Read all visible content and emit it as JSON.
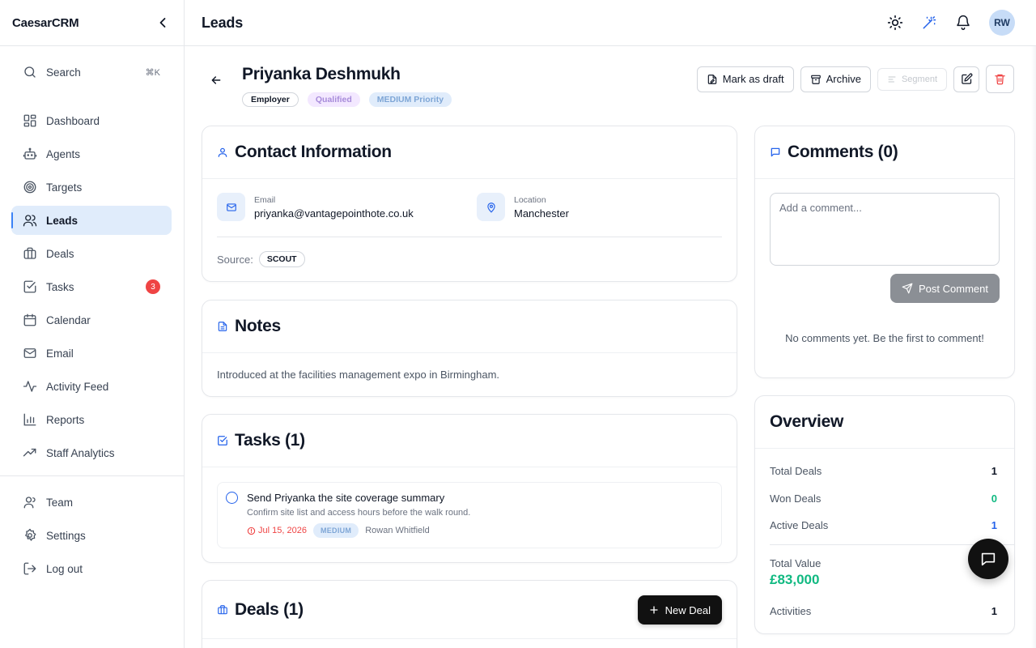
{
  "app": {
    "brand": "CaesarCRM"
  },
  "sidebar": {
    "search": {
      "label": "Search",
      "shortcut": "⌘K"
    },
    "items": [
      {
        "label": "Dashboard",
        "icon": "dashboard-icon"
      },
      {
        "label": "Agents",
        "icon": "bot-icon"
      },
      {
        "label": "Targets",
        "icon": "target-icon"
      },
      {
        "label": "Leads",
        "icon": "users-icon",
        "active": true
      },
      {
        "label": "Deals",
        "icon": "briefcase-icon"
      },
      {
        "label": "Tasks",
        "icon": "check-square-icon",
        "badge": "3"
      },
      {
        "label": "Calendar",
        "icon": "calendar-icon"
      },
      {
        "label": "Email",
        "icon": "mail-icon"
      },
      {
        "label": "Activity Feed",
        "icon": "activity-icon"
      },
      {
        "label": "Reports",
        "icon": "bar-chart-icon"
      },
      {
        "label": "Staff Analytics",
        "icon": "trending-up-icon"
      }
    ],
    "bottom_items": [
      {
        "label": "Team",
        "icon": "user-icon"
      },
      {
        "label": "Settings",
        "icon": "gear-icon"
      },
      {
        "label": "Log out",
        "icon": "logout-icon"
      }
    ]
  },
  "topbar": {
    "title": "Leads",
    "avatar_initials": "RW"
  },
  "lead": {
    "name": "Priyanka Deshmukh",
    "tags": {
      "type": "Employer",
      "status": "Qualified",
      "priority": "MEDIUM Priority"
    }
  },
  "actions": {
    "mark_draft": "Mark as draft",
    "archive": "Archive",
    "segment": "Segment"
  },
  "contact": {
    "title": "Contact Information",
    "email_label": "Email",
    "email": "priyanka@vantagepointhote.co.uk",
    "location_label": "Location",
    "location": "Manchester",
    "source_label": "Source:",
    "source": "SCOUT"
  },
  "notes": {
    "title": "Notes",
    "text": "Introduced at the facilities management expo in Birmingham."
  },
  "tasks": {
    "title": "Tasks (1)",
    "items": [
      {
        "title": "Send Priyanka the site coverage summary",
        "description": "Confirm site list and access hours before the walk round.",
        "due": "Jul 15, 2026",
        "priority": "MEDIUM",
        "assignee": "Rowan Whitfield"
      }
    ]
  },
  "deals": {
    "title": "Deals (1)",
    "new_deal": "New Deal"
  },
  "comments": {
    "title": "Comments (0)",
    "placeholder": "Add a comment...",
    "post": "Post Comment",
    "empty": "No comments yet. Be the first to comment!"
  },
  "overview": {
    "title": "Overview",
    "total_deals_label": "Total Deals",
    "total_deals": "1",
    "won_deals_label": "Won Deals",
    "won_deals": "0",
    "active_deals_label": "Active Deals",
    "active_deals": "1",
    "total_value_label": "Total Value",
    "total_value": "£83,000",
    "activities_label": "Activities",
    "activities": "1"
  },
  "colors": {
    "accent": "#2563eb",
    "active_bg": "#e0ecfb",
    "success": "#10b981",
    "danger": "#ef4444"
  }
}
